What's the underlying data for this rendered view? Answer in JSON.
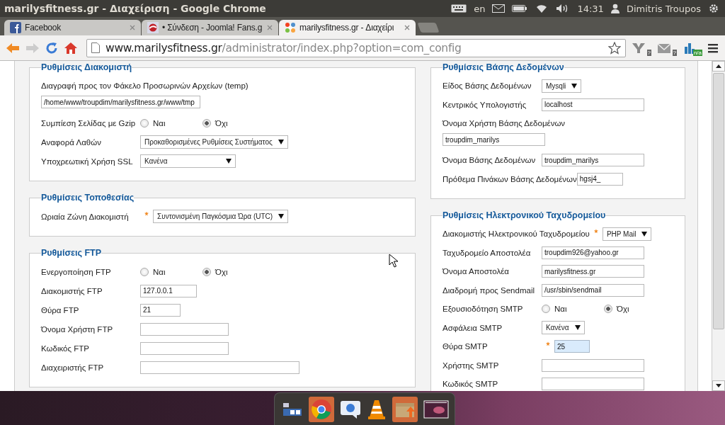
{
  "top_panel": {
    "title": "marilysfitness.gr - Διαχείριση - Google Chrome",
    "keyboard_layout": "en",
    "time": "14:31",
    "user": "Dimitris Troupos"
  },
  "tabs": [
    {
      "label": "Facebook",
      "selected": false,
      "kind": "facebook"
    },
    {
      "label": "• Σύνδεση - Joomla! Fans.g",
      "selected": false,
      "kind": "fans"
    },
    {
      "label": "marilysfitness.gr - Διαχείρι",
      "selected": true,
      "kind": "joomla"
    }
  ],
  "address_bar": {
    "host": "www.marilysfitness.gr",
    "path": "/administrator/index.php?option=com_config"
  },
  "extensions": [
    {
      "kind": "y",
      "badge": "?"
    },
    {
      "kind": "mail",
      "badge": "?"
    },
    {
      "kind": "chart",
      "badge": "n/a"
    }
  ],
  "left_column": [
    {
      "legend": "Ρυθμίσεις Διακομιστή",
      "fields": [
        {
          "kind": "text",
          "stacked": true,
          "label": "Διαγραφή προς τον Φάκελο Προσωρινών Αρχείων (temp)",
          "required": false,
          "value": "/home/www/troupdim/marilysfitness.gr/www/tmp",
          "focused": false
        },
        {
          "kind": "radio",
          "stacked": false,
          "label": "Συμπίεση Σελίδας με Gzip",
          "required": false,
          "options": [
            {
              "label": "Ναι",
              "selected": false
            },
            {
              "label": "Όχι",
              "selected": true
            }
          ]
        },
        {
          "kind": "select",
          "stacked": false,
          "label": "Αναφορά Λαθών",
          "required": false,
          "value": "Προκαθορισμένες Ρυθμίσεις Συστήματος"
        },
        {
          "kind": "select",
          "stacked": false,
          "label": "Υποχρεωτική Χρήση SSL",
          "required": false,
          "value": "Κανένα"
        }
      ]
    },
    {
      "legend": "Ρυθμίσεις Τοποθεσίας",
      "fields": [
        {
          "kind": "select",
          "stacked": false,
          "label": "Ωριαία Ζώνη Διακομιστή",
          "required": true,
          "value": "Συντονισμένη Παγκόσμια Ώρα (UTC)"
        }
      ]
    },
    {
      "legend": "Ρυθμίσεις FTP",
      "fields": [
        {
          "kind": "radio",
          "stacked": false,
          "label": "Ενεργοποίηση FTP",
          "required": false,
          "options": [
            {
              "label": "Ναι",
              "selected": false
            },
            {
              "label": "Όχι",
              "selected": true
            }
          ]
        },
        {
          "kind": "text",
          "stacked": false,
          "label": "Διακομιστής FTP",
          "required": false,
          "value": "127.0.0.1",
          "focused": false
        },
        {
          "kind": "text",
          "stacked": false,
          "label": "Θύρα FTP",
          "required": false,
          "value": "21",
          "focused": false
        },
        {
          "kind": "text",
          "stacked": false,
          "label": "Όνομα Χρήστη FTP",
          "required": false,
          "focused": false
        },
        {
          "kind": "text",
          "stacked": false,
          "label": "Κωδικός FTP",
          "required": false,
          "focused": false
        },
        {
          "kind": "text",
          "stacked": false,
          "label": "Διαχειριστής FTP",
          "required": false,
          "focused": false
        }
      ]
    }
  ],
  "right_column": [
    {
      "legend": "Ρυθμίσεις Βάσης Δεδομένων",
      "fields": [
        {
          "kind": "select",
          "stacked": false,
          "label": "Είδος Βάσης Δεδομένων",
          "required": false,
          "value": "Mysqli"
        },
        {
          "kind": "text",
          "stacked": false,
          "label": "Κεντρικός Υπολογιστής",
          "required": false,
          "value": "localhost",
          "focused": false
        },
        {
          "kind": "text",
          "stacked": true,
          "label": "Όνομα Χρήστη Βάσης Δεδομένων",
          "required": false,
          "value": "troupdim_marilys",
          "focused": false
        },
        {
          "kind": "text",
          "stacked": false,
          "label": "Όνομα Βάσης Δεδομένων",
          "required": false,
          "value": "troupdim_marilys",
          "focused": false
        },
        {
          "kind": "text",
          "stacked": false,
          "label": "Πρόθεμα Πινάκων Βάσης Δεδομένων",
          "required": false,
          "value": "hgsj4_",
          "focused": false
        }
      ]
    },
    {
      "legend": "Ρυθμίσεις Ηλεκτρονικού Ταχυδρομείου",
      "fields": [
        {
          "kind": "select",
          "stacked": false,
          "label": "Διακομιστής Ηλεκτρονικού Ταχυδρομείου",
          "required": true,
          "value": "PHP Mail"
        },
        {
          "kind": "text",
          "stacked": false,
          "label": "Ταχυδρομείο Αποστολέα",
          "required": false,
          "value": "troupdim926@yahoo.gr",
          "focused": false
        },
        {
          "kind": "text",
          "stacked": false,
          "label": "Όνομα Αποστολέα",
          "required": false,
          "value": "marilysfitness.gr",
          "focused": false
        },
        {
          "kind": "text",
          "stacked": false,
          "label": "Διαδρομή προς Sendmail",
          "required": false,
          "value": "/usr/sbin/sendmail",
          "focused": false
        },
        {
          "kind": "radio",
          "stacked": false,
          "label": "Εξουσιοδότηση SMTP",
          "required": false,
          "options": [
            {
              "label": "Ναι",
              "selected": false
            },
            {
              "label": "Όχι",
              "selected": true
            }
          ]
        },
        {
          "kind": "select",
          "stacked": false,
          "label": "Ασφάλεια SMTP",
          "required": false,
          "value": "Κανένα"
        },
        {
          "kind": "text",
          "stacked": false,
          "label": "Θύρα SMTP",
          "required": true,
          "value": "25",
          "focused": true
        },
        {
          "kind": "text",
          "stacked": false,
          "label": "Χρήστης SMTP",
          "required": false,
          "focused": false
        },
        {
          "kind": "text",
          "stacked": false,
          "label": "Κωδικός SMTP",
          "required": false,
          "focused": false
        }
      ]
    }
  ]
}
